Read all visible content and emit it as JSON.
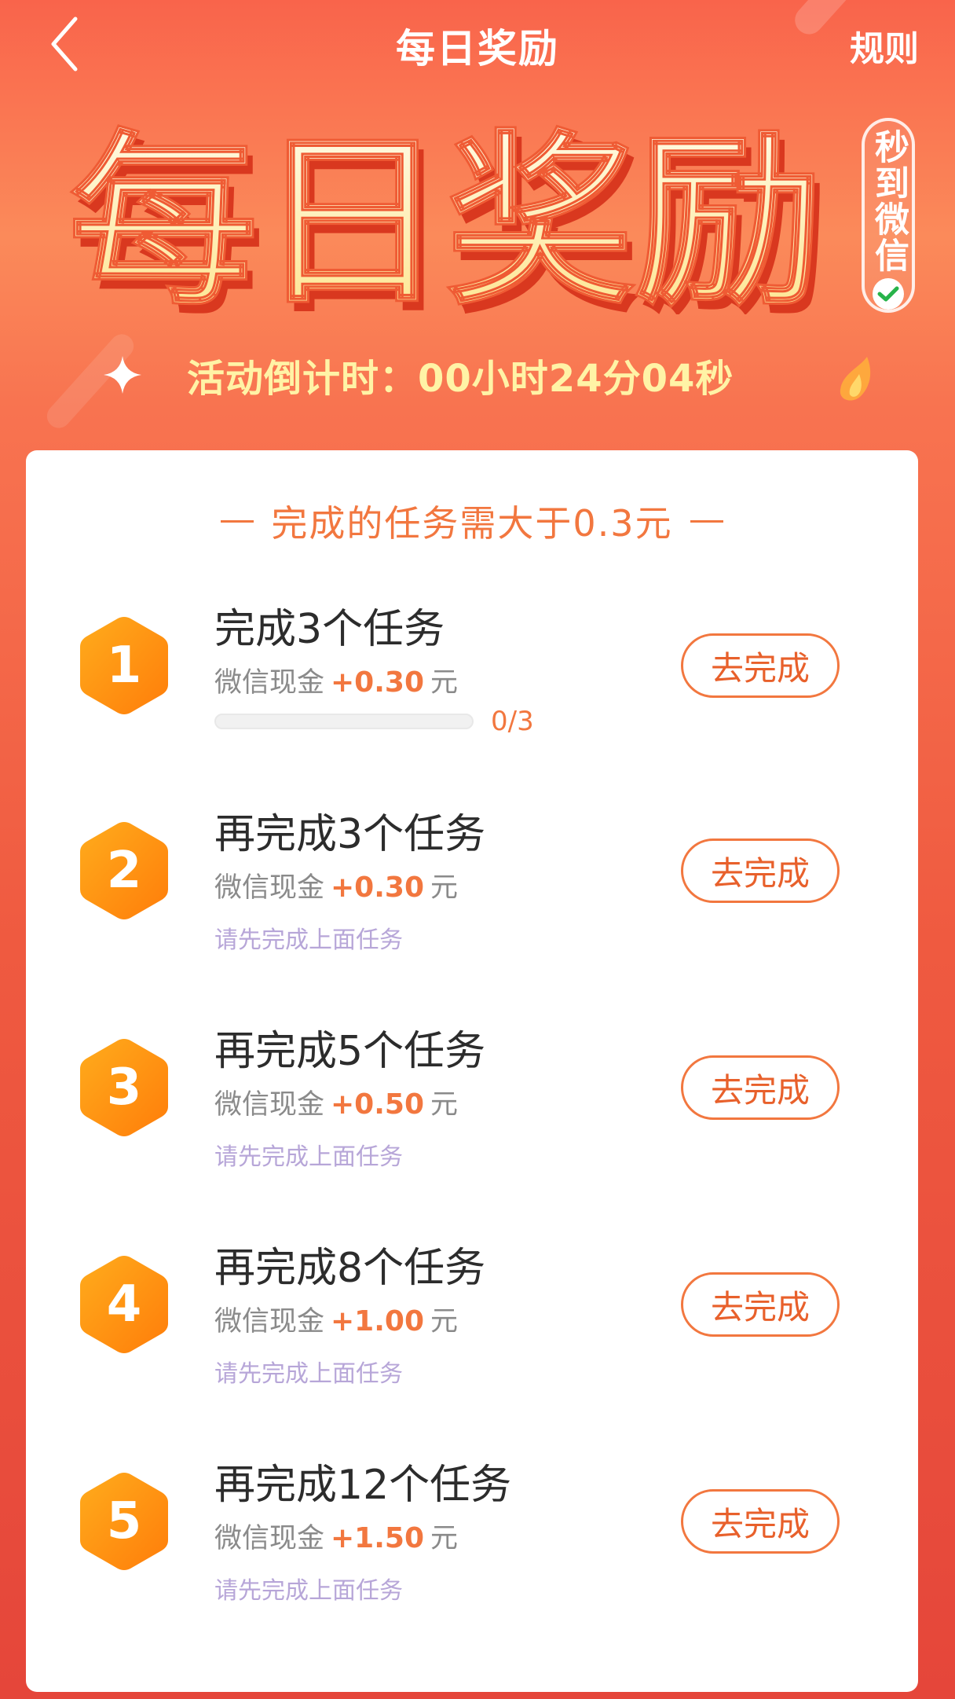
{
  "nav": {
    "title": "每日奖励",
    "rules_label": "规则"
  },
  "hero": {
    "title": "每日奖励",
    "badge": "秒到微信",
    "countdown": "活动倒计时：00小时24分04秒"
  },
  "card": {
    "header": "完成的任务需大于0.3元",
    "tasks": [
      {
        "index": "1",
        "title": "完成3个任务",
        "reward_prefix": "微信现金",
        "amount": "+0.30",
        "unit": "元",
        "progress_text": "0/3",
        "progress": 0,
        "hint": "",
        "button": "去完成"
      },
      {
        "index": "2",
        "title": "再完成3个任务",
        "reward_prefix": "微信现金",
        "amount": "+0.30",
        "unit": "元",
        "hint": "请先完成上面任务",
        "button": "去完成"
      },
      {
        "index": "3",
        "title": "再完成5个任务",
        "reward_prefix": "微信现金",
        "amount": "+0.50",
        "unit": "元",
        "hint": "请先完成上面任务",
        "button": "去完成"
      },
      {
        "index": "4",
        "title": "再完成8个任务",
        "reward_prefix": "微信现金",
        "amount": "+1.00",
        "unit": "元",
        "hint": "请先完成上面任务",
        "button": "去完成"
      },
      {
        "index": "5",
        "title": "再完成12个任务",
        "reward_prefix": "微信现金",
        "amount": "+1.50",
        "unit": "元",
        "hint": "请先完成上面任务",
        "button": "去完成"
      }
    ]
  },
  "colors": {
    "accent": "#f2773f",
    "hint": "#b7a6d8",
    "countdown": "#fff3a6"
  },
  "icons": [
    "back-arrow-icon",
    "sparkle-icon",
    "flame-icon",
    "check-icon",
    "hexagon-badge-icon"
  ]
}
